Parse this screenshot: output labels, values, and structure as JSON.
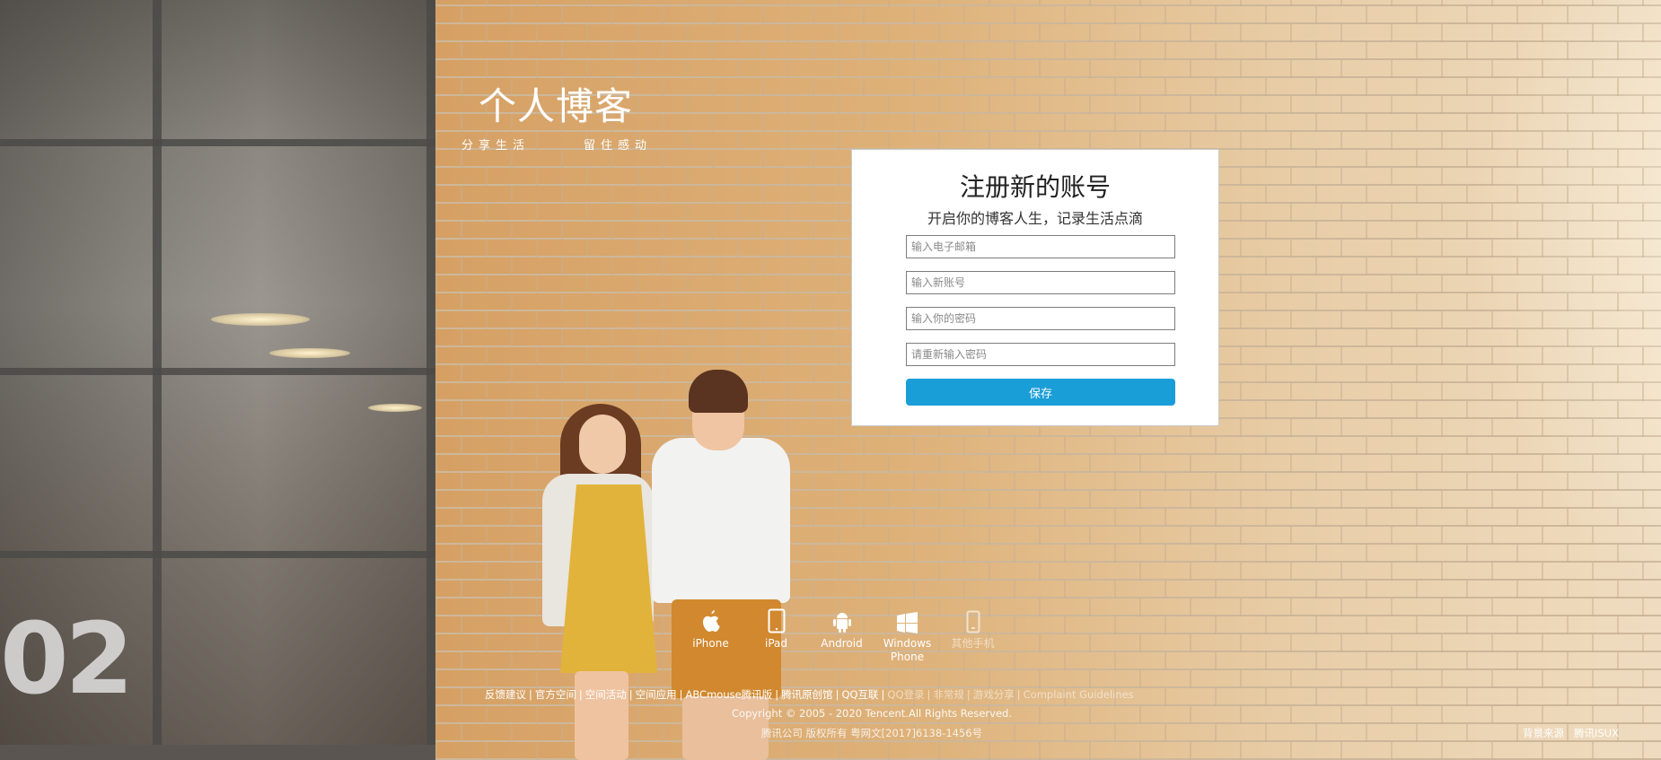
{
  "brand": {
    "title": "个人博客",
    "slogan_left": "分享生活",
    "slogan_right": "留住感动"
  },
  "register": {
    "title": "注册新的账号",
    "subtitle": "开启你的博客人生，记录生活点滴",
    "email_placeholder": "输入电子邮箱",
    "email_value": "",
    "account_placeholder": "输入新账号",
    "account_value": "",
    "password_placeholder": "输入你的密码",
    "password_value": "",
    "confirm_placeholder": "请重新输入密码",
    "confirm_value": "",
    "save_label": "保存",
    "save_color": "#1a9ed8"
  },
  "apps": [
    {
      "label": "iPhone",
      "icon": "apple-icon"
    },
    {
      "label": "iPad",
      "icon": "tablet-icon"
    },
    {
      "label": "Android",
      "icon": "android-icon"
    },
    {
      "label": "Windows Phone",
      "icon": "windows-icon"
    },
    {
      "label": "其他手机",
      "icon": "phone-icon"
    }
  ],
  "footer": {
    "links": [
      "反馈建议",
      "官方空间",
      "空间活动",
      "空间应用",
      "ABCmouse腾讯版",
      "腾讯原创馆",
      "QQ互联",
      "QQ登录",
      "非常规",
      "游戏分享",
      "Complaint Guidelines"
    ],
    "copyright": "Copyright © 2005 - 2020 Tencent.All Rights Reserved.",
    "license": "腾讯公司 版权所有 粤网文[2017]6138-1456号",
    "corner_left": "背景来源",
    "corner_right": "腾讯ISUX"
  },
  "background_number": "02"
}
